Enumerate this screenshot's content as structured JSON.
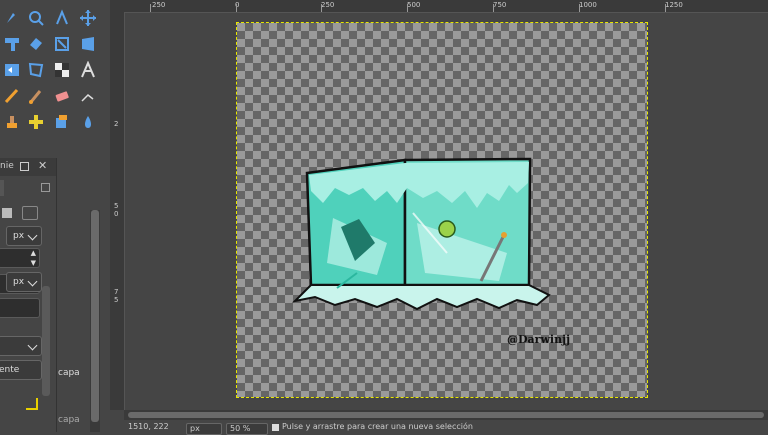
{
  "dock": {
    "title_fragment": "nie",
    "unit_1": "px",
    "unit_2": "px",
    "button_text": "ente",
    "layer_label": "capa",
    "layer_label_2": "capa"
  },
  "ruler": {
    "top_labels": [
      "250",
      "0",
      "250",
      "500",
      "750",
      "1000",
      "1250"
    ],
    "left_labels": [
      "2",
      "5",
      "0",
      "7",
      "5"
    ]
  },
  "canvas": {
    "signature": "@Darwinjj"
  },
  "statusbar": {
    "coords": "1510, 222",
    "unit": "px",
    "zoom": "50 %",
    "message": "Pulse y arrastre para crear una nueva selección"
  },
  "colors": {
    "ice": "#7fe3d2",
    "ice_dark": "#2bb79f",
    "selection": "#e8e800"
  }
}
